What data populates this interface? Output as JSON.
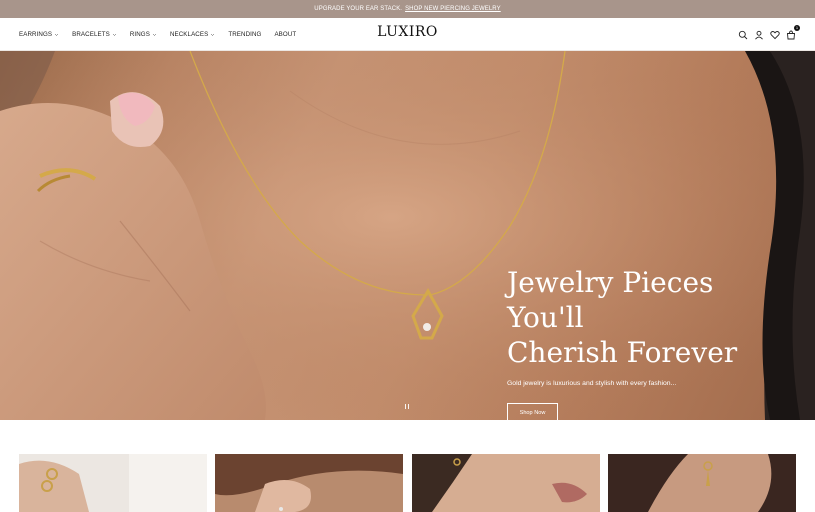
{
  "announcement": {
    "text": "UPGRADE YOUR EAR STACK.",
    "link": "SHOP NEW PIERCING JEWELRY"
  },
  "nav": {
    "items": [
      {
        "label": "EARRINGS",
        "has_dropdown": true
      },
      {
        "label": "BRACELETS",
        "has_dropdown": true
      },
      {
        "label": "RINGS",
        "has_dropdown": true
      },
      {
        "label": "NECKLACES",
        "has_dropdown": true
      },
      {
        "label": "TRENDING",
        "has_dropdown": false
      },
      {
        "label": "ABOUT",
        "has_dropdown": false
      }
    ]
  },
  "logo": "LUXIRO",
  "header_icons": [
    "search-icon",
    "account-icon",
    "wishlist-heart-icon",
    "cart-bag-icon"
  ],
  "cart": {
    "count": "1"
  },
  "hero": {
    "title_line1": "Jewelry Pieces You'll",
    "title_line2": "Cherish Forever",
    "subtitle": "Gold jewelry is luxurious and stylish with every fashion...",
    "button": "Shop Now"
  },
  "colors": {
    "announcement_bg": "#a8958b",
    "accent_gold": "#d4a94a"
  }
}
